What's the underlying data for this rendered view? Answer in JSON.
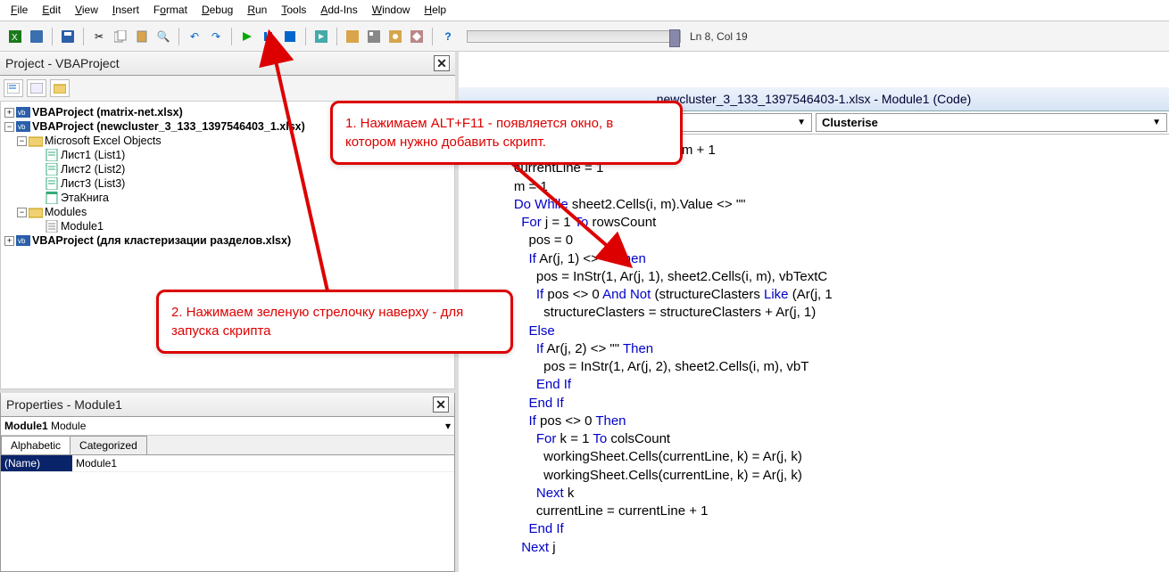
{
  "menu": {
    "items": [
      {
        "label": "File",
        "u": "F"
      },
      {
        "label": "Edit",
        "u": "E"
      },
      {
        "label": "View",
        "u": "V"
      },
      {
        "label": "Insert",
        "u": "I"
      },
      {
        "label": "Format",
        "u": "o"
      },
      {
        "label": "Debug",
        "u": "D"
      },
      {
        "label": "Run",
        "u": "R"
      },
      {
        "label": "Tools",
        "u": "T"
      },
      {
        "label": "Add-Ins",
        "u": "A"
      },
      {
        "label": "Window",
        "u": "W"
      },
      {
        "label": "Help",
        "u": "H"
      }
    ]
  },
  "toolbar": {
    "cursor_pos": "Ln 8, Col 19"
  },
  "project_pane": {
    "title": "Project - VBAProject",
    "tree": [
      {
        "level": 0,
        "exp": "+",
        "bold": true,
        "icon": "vba",
        "label": "VBAProject (matrix-net.xlsx)"
      },
      {
        "level": 0,
        "exp": "−",
        "bold": true,
        "icon": "vba",
        "label": "VBAProject (newcluster_3_133_1397546403_1.xlsx)"
      },
      {
        "level": 1,
        "exp": "−",
        "bold": false,
        "icon": "folder",
        "label": "Microsoft Excel Objects"
      },
      {
        "level": 2,
        "exp": "",
        "bold": false,
        "icon": "sheet",
        "label": "Лист1 (List1)"
      },
      {
        "level": 2,
        "exp": "",
        "bold": false,
        "icon": "sheet",
        "label": "Лист2 (List2)"
      },
      {
        "level": 2,
        "exp": "",
        "bold": false,
        "icon": "sheet",
        "label": "Лист3 (List3)"
      },
      {
        "level": 2,
        "exp": "",
        "bold": false,
        "icon": "book",
        "label": "ЭтаКнига"
      },
      {
        "level": 1,
        "exp": "−",
        "bold": false,
        "icon": "folder",
        "label": "Modules"
      },
      {
        "level": 2,
        "exp": "",
        "bold": false,
        "icon": "module",
        "label": "Module1"
      },
      {
        "level": 0,
        "exp": "+",
        "bold": true,
        "icon": "vba",
        "label": "VBAProject (для кластеризации разделов.xlsx)"
      }
    ]
  },
  "properties_pane": {
    "title": "Properties - Module1",
    "object": "Module1",
    "object_type": "Module",
    "tabs": [
      "Alphabetic",
      "Categorized"
    ],
    "rows": [
      {
        "name": "(Name)",
        "value": "Module1"
      }
    ]
  },
  "code_window": {
    "title": "newcluster_3_133_1397546403-1.xlsx - Module1 (Code)",
    "left_dd": "",
    "right_dd": "Clusterise"
  },
  "callouts": {
    "c1": "1. Нажимаем ALT+F11  - появляется окно, в котором нужно добавить скрипт.",
    "c2": "2.  Нажимаем зеленую стрелочку наверху - для запуска скрипта"
  },
  "code_lines": [
    {
      "indent": 15,
      "parts": [
        [
          "",
          "etNum = workingSheetNum + 1"
        ]
      ]
    },
    {
      "indent": 11,
      "parts": [
        [
          "",
          "currentLine = 1"
        ]
      ]
    },
    {
      "indent": 11,
      "parts": [
        [
          "",
          "m = 1"
        ]
      ]
    },
    {
      "indent": 11,
      "parts": [
        [
          "kw",
          "Do While"
        ],
        [
          "",
          " sheet2.Cells(i, m).Value <> \"\""
        ]
      ]
    },
    {
      "indent": 13,
      "parts": [
        [
          "kw",
          "For"
        ],
        [
          "",
          " j = 1 "
        ],
        [
          "kw",
          "To"
        ],
        [
          "",
          " rowsCount"
        ]
      ]
    },
    {
      "indent": 15,
      "parts": [
        [
          "",
          "pos = 0"
        ]
      ]
    },
    {
      "indent": 15,
      "parts": [
        [
          "kw",
          "If"
        ],
        [
          "",
          " Ar(j, 1) <> \"\" "
        ],
        [
          "kw",
          "Then"
        ]
      ]
    },
    {
      "indent": 17,
      "parts": [
        [
          "",
          "pos = InStr(1, Ar(j, 1), sheet2.Cells(i, m), vbTextC"
        ]
      ]
    },
    {
      "indent": 17,
      "parts": [
        [
          "kw",
          "If"
        ],
        [
          "",
          " pos <> 0 "
        ],
        [
          "kw",
          "And Not"
        ],
        [
          "",
          " (structureClasters "
        ],
        [
          "kw",
          "Like"
        ],
        [
          "",
          " (Ar(j, 1"
        ]
      ]
    },
    {
      "indent": 19,
      "parts": [
        [
          "",
          "structureClasters = structureClasters + Ar(j, 1)"
        ]
      ]
    },
    {
      "indent": 15,
      "parts": [
        [
          "kw",
          "Else"
        ]
      ]
    },
    {
      "indent": 17,
      "parts": [
        [
          "kw",
          "If"
        ],
        [
          "",
          " Ar(j, 2) <> \"\" "
        ],
        [
          "kw",
          "Then"
        ]
      ]
    },
    {
      "indent": 19,
      "parts": [
        [
          "",
          "pos = InStr(1, Ar(j, 2), sheet2.Cells(i, m), vbT"
        ]
      ]
    },
    {
      "indent": 17,
      "parts": [
        [
          "kw",
          "End If"
        ]
      ]
    },
    {
      "indent": 15,
      "parts": [
        [
          "kw",
          "End If"
        ]
      ]
    },
    {
      "indent": 15,
      "parts": [
        [
          "kw",
          "If"
        ],
        [
          "",
          " pos <> 0 "
        ],
        [
          "kw",
          "Then"
        ]
      ]
    },
    {
      "indent": 17,
      "parts": [
        [
          "kw",
          "For"
        ],
        [
          "",
          " k = 1 "
        ],
        [
          "kw",
          "To"
        ],
        [
          "",
          " colsCount"
        ]
      ]
    },
    {
      "indent": 19,
      "parts": [
        [
          "",
          "workingSheet.Cells(currentLine, k) = Ar(j, k)"
        ]
      ]
    },
    {
      "indent": 19,
      "parts": [
        [
          "",
          "workingSheet.Cells(currentLine, k) = Ar(j, k)"
        ]
      ]
    },
    {
      "indent": 17,
      "parts": [
        [
          "kw",
          "Next"
        ],
        [
          "",
          " k"
        ]
      ]
    },
    {
      "indent": 17,
      "parts": [
        [
          "",
          "currentLine = currentLine + 1"
        ]
      ]
    },
    {
      "indent": 15,
      "parts": [
        [
          "kw",
          "End If"
        ]
      ]
    },
    {
      "indent": 13,
      "parts": [
        [
          "kw",
          "Next"
        ],
        [
          "",
          " j"
        ]
      ]
    }
  ]
}
